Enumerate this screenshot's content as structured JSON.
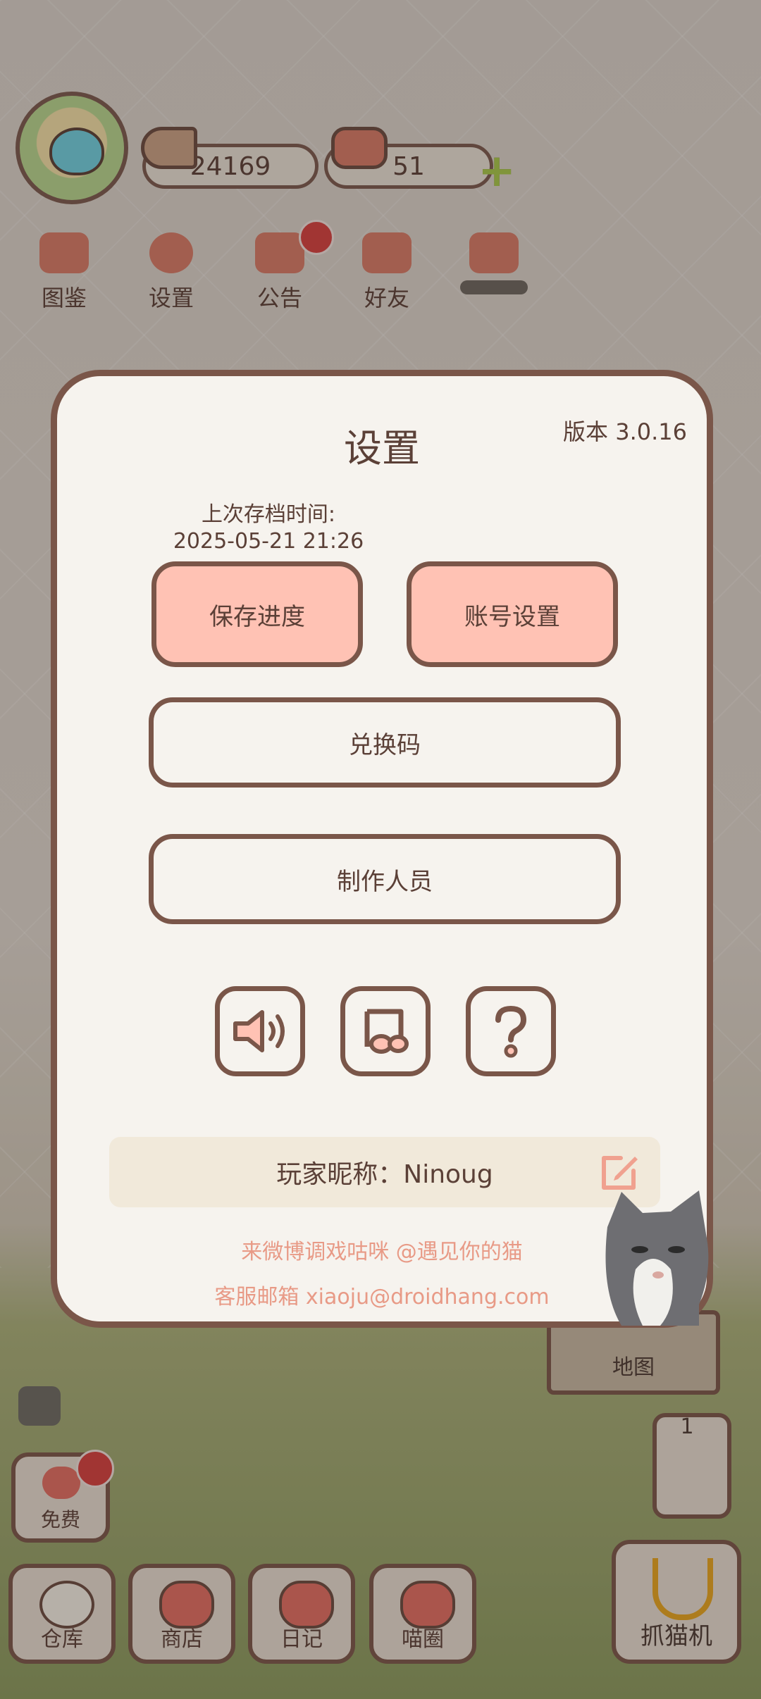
{
  "hud": {
    "coins": "24169",
    "hearts": "51",
    "plus_icon": "plus-icon",
    "menu": [
      {
        "label": "图鉴",
        "icon": "cat-face-icon"
      },
      {
        "label": "设置",
        "icon": "gear-icon"
      },
      {
        "label": "公告",
        "icon": "gift-icon",
        "badge": true
      },
      {
        "label": "好友",
        "icon": "friends-icon"
      },
      {
        "label": "",
        "icon": "hearts-icon",
        "badge": true
      }
    ]
  },
  "dialog": {
    "title": "设置",
    "version": "版本 3.0.16",
    "last_save_label": "上次存档时间:",
    "last_save_time": "2025-05-21 21:26",
    "save_button": "保存进度",
    "account_button": "账号设置",
    "redeem_button": "兑换码",
    "credits_button": "制作人员",
    "icon_buttons": [
      "sound-icon",
      "music-icon",
      "help-icon"
    ],
    "nickname": "玩家昵称：Ninoug",
    "weibo_line": "来微博调戏咕咪 @遇见你的猫",
    "email_line": "客服邮箱 xiaoju@droidhang.com"
  },
  "scene": {
    "map_label": "地图",
    "ticket_count": "1",
    "free_label": "免费",
    "tabs": [
      "仓库",
      "商店",
      "日记",
      "喵圈"
    ],
    "claw_label": "抓猫机"
  },
  "colors": {
    "accent_pink": "#ffc2b4",
    "border_brown": "#7a5649",
    "text_brown": "#5b4037",
    "link_salmon": "#e89a86",
    "badge_red": "#d6403e"
  }
}
